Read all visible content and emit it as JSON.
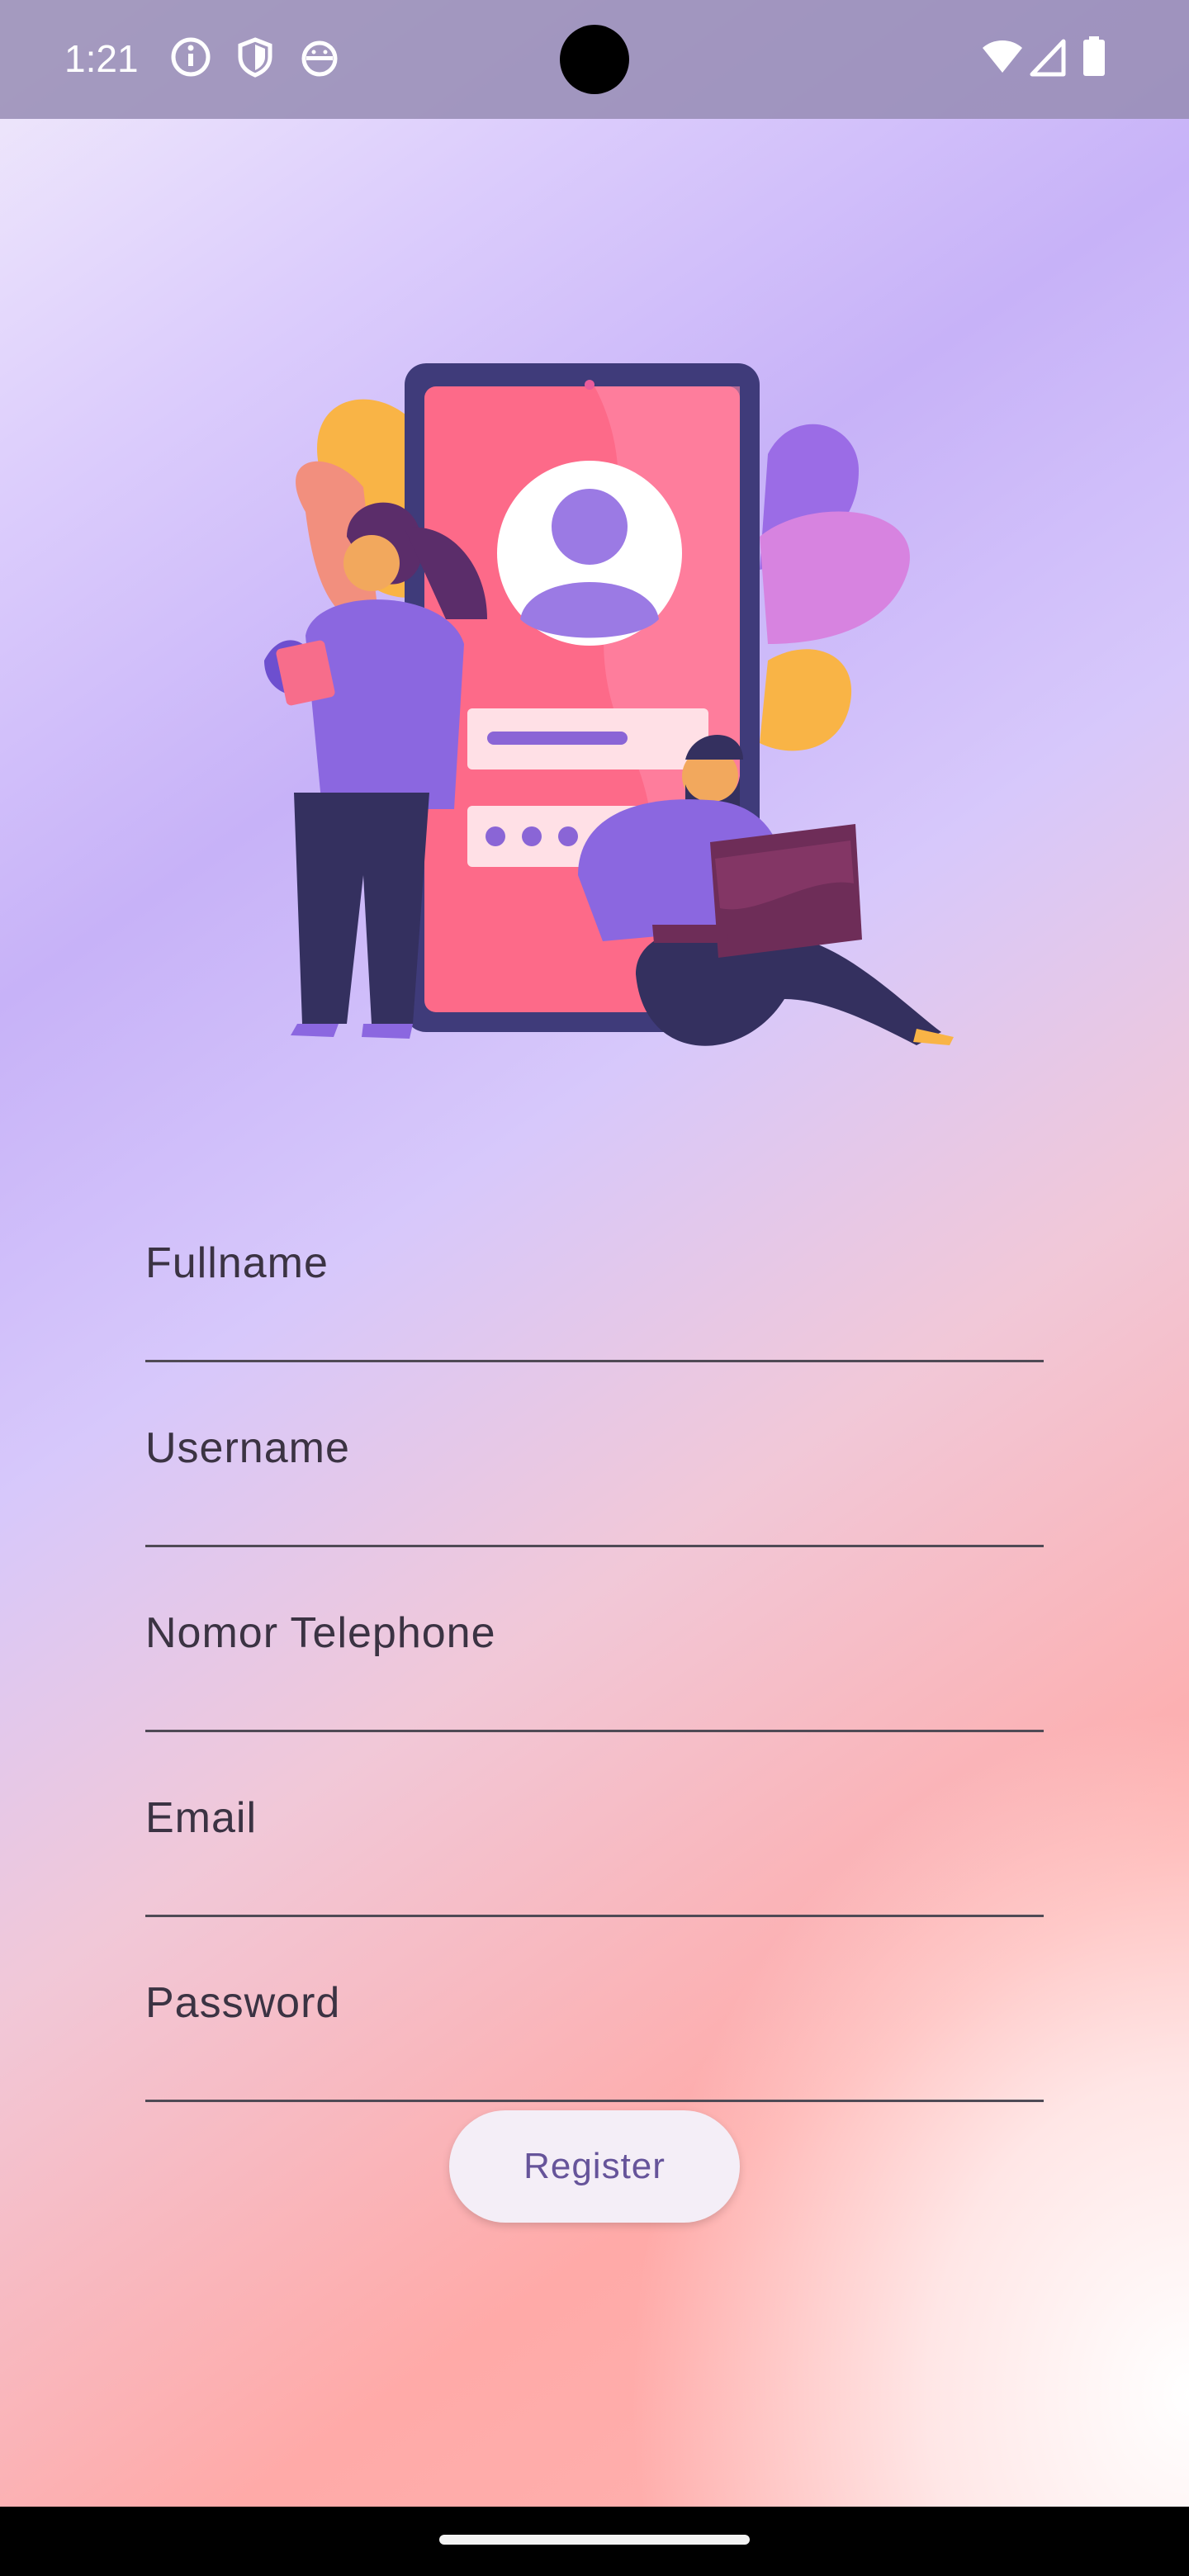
{
  "status_bar": {
    "time": "1:21",
    "left_icons": [
      "info-icon",
      "shield-icon",
      "android-icon"
    ],
    "right_icons": [
      "wifi-icon",
      "signal-icon",
      "battery-icon"
    ]
  },
  "illustration": {
    "description_icon": "register-illustration-icon"
  },
  "form": {
    "fields": [
      {
        "label": "Fullname",
        "value": ""
      },
      {
        "label": "Username",
        "value": ""
      },
      {
        "label": "Nomor Telephone",
        "value": ""
      },
      {
        "label": "Email",
        "value": ""
      },
      {
        "label": "Password",
        "value": ""
      }
    ],
    "register_label": "Register"
  },
  "colors": {
    "button_text": "#66549a",
    "label_text": "#3b3343",
    "underline": "#4f4a55"
  }
}
